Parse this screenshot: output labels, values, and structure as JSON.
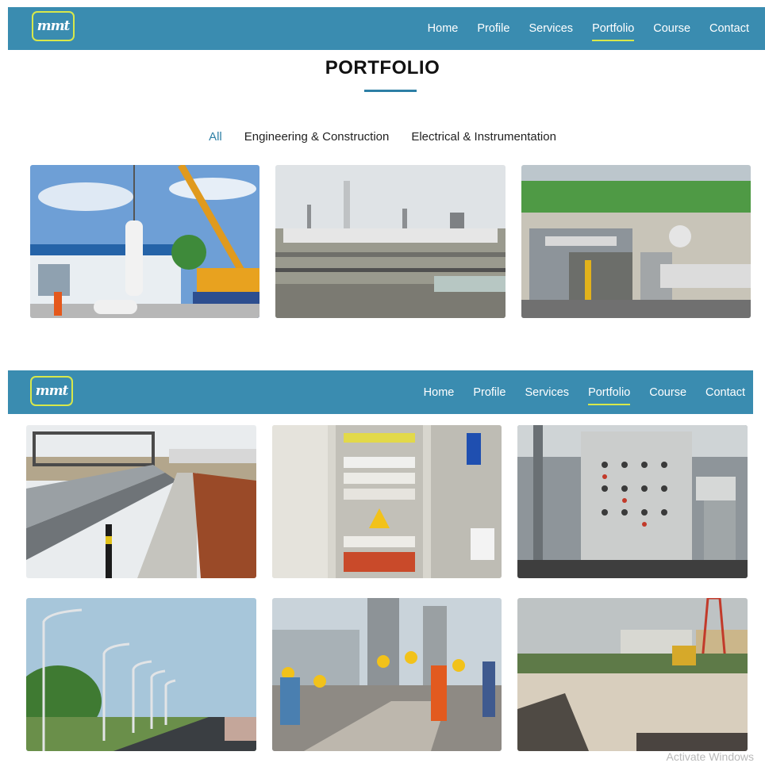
{
  "brand": {
    "logo_text": "mmt"
  },
  "nav": {
    "items": [
      {
        "label": "Home",
        "active": false
      },
      {
        "label": "Profile",
        "active": false
      },
      {
        "label": "Services",
        "active": false
      },
      {
        "label": "Portfolio",
        "active": true
      },
      {
        "label": "Course",
        "active": false
      },
      {
        "label": "Contact",
        "active": false
      }
    ]
  },
  "section": {
    "title": "PORTFOLIO"
  },
  "filters": [
    "All",
    "Engineering & Construction",
    "Electrical & Instrumentation"
  ],
  "system": {
    "watermark": "Activate Windows"
  },
  "colors": {
    "navbar": "#3a8cb0",
    "accent": "#2d7fa5",
    "highlight": "#d8e84a"
  }
}
